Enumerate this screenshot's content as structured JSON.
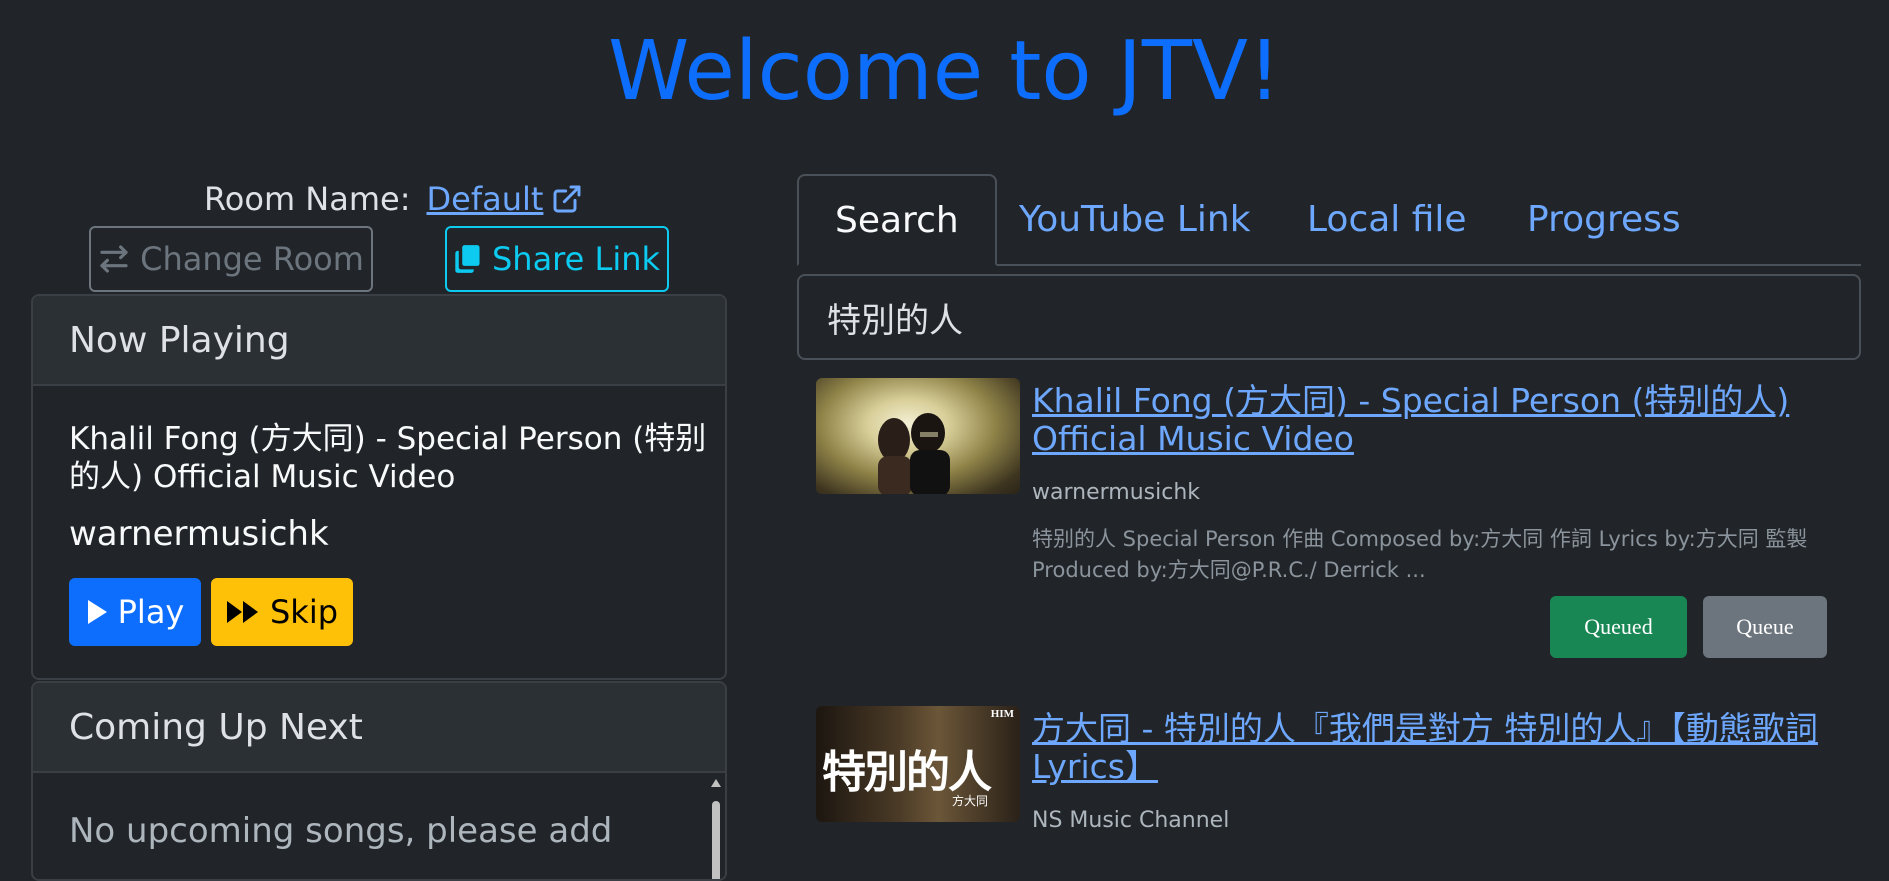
{
  "page": {
    "title": "Welcome to JTV!"
  },
  "room": {
    "label": "Room Name:",
    "name": "Default",
    "change_room_label": "Change Room",
    "share_link_label": "Share Link"
  },
  "now_playing": {
    "header": "Now Playing",
    "title": "Khalil Fong (方大同) - Special Person (特别的人) Official Music Video",
    "channel": "warnermusichk",
    "play_label": "Play",
    "skip_label": "Skip"
  },
  "coming_up": {
    "header": "Coming Up Next",
    "empty_message": "No upcoming songs, please add"
  },
  "tabs": [
    {
      "label": "Search",
      "active": true
    },
    {
      "label": "YouTube Link",
      "active": false
    },
    {
      "label": "Local file",
      "active": false
    },
    {
      "label": "Progress",
      "active": false
    }
  ],
  "search": {
    "value": "特別的人"
  },
  "results": [
    {
      "title": "Khalil Fong (方大同) - Special Person (特别的人) Official Music Video",
      "channel": "warnermusichk",
      "description": "特别的人 Special Person 作曲 Composed by:方大同 作詞 Lyrics by:方大同 監製 Produced by:方大同@P.R.C./ Derrick ...",
      "queued_label": "Queued",
      "queue_label": "Queue"
    },
    {
      "title": "方大同 - 特別的人『我們是對方 特別的人』【動態歌詞 Lyrics】",
      "channel": "NS Music Channel",
      "thumb_text": "特別的人",
      "thumb_sub": "方大同",
      "thumb_badge": "HIM"
    }
  ],
  "colors": {
    "background": "#212529",
    "primary": "#0d6efd",
    "link": "#6ea8fe",
    "info": "#0dcaf0",
    "warning": "#ffc107",
    "success": "#198754",
    "secondary": "#6c757d"
  }
}
